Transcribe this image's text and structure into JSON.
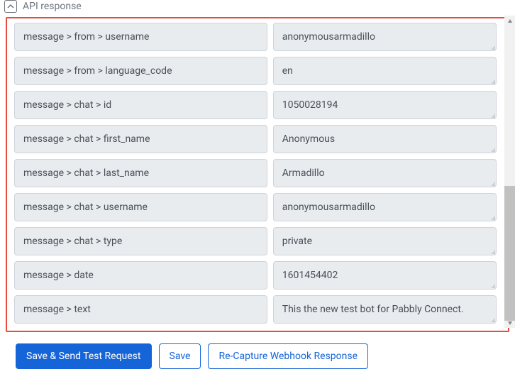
{
  "section_title": "API response",
  "rows": [
    {
      "key": "message > from > username",
      "value": "anonymousarmadillo"
    },
    {
      "key": "message > from > language_code",
      "value": "en"
    },
    {
      "key": "message > chat > id",
      "value": "1050028194"
    },
    {
      "key": "message > chat > first_name",
      "value": "Anonymous"
    },
    {
      "key": "message > chat > last_name",
      "value": "Armadillo"
    },
    {
      "key": "message > chat > username",
      "value": "anonymousarmadillo"
    },
    {
      "key": "message > chat > type",
      "value": "private"
    },
    {
      "key": "message > date",
      "value": "1601454402"
    },
    {
      "key": "message > text",
      "value": "This the new test bot for Pabbly Connect."
    }
  ],
  "buttons": {
    "save_send": "Save & Send Test Request",
    "save": "Save",
    "recapture": "Re-Capture Webhook Response"
  }
}
